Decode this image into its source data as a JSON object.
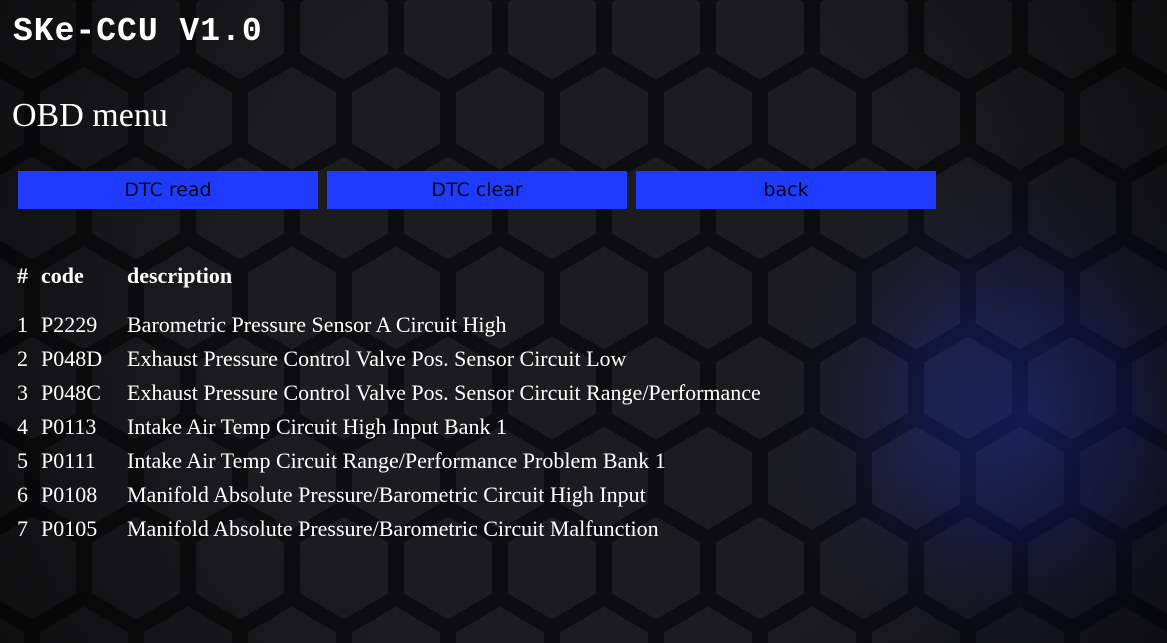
{
  "app": {
    "title": "SKe-CCU V1.0"
  },
  "page": {
    "title": "OBD menu"
  },
  "toolbar": {
    "dtc_read_label": "DTC read",
    "dtc_clear_label": "DTC clear",
    "back_label": "back"
  },
  "dtc_table": {
    "headers": {
      "index": "#",
      "code": "code",
      "description": "description"
    },
    "rows": [
      {
        "index": "1",
        "code": "P2229",
        "description": "Barometric Pressure Sensor A Circuit High"
      },
      {
        "index": "2",
        "code": "P048D",
        "description": "Exhaust Pressure Control Valve Pos. Sensor Circuit Low"
      },
      {
        "index": "3",
        "code": "P048C",
        "description": "Exhaust Pressure Control Valve Pos. Sensor Circuit Range/Performance"
      },
      {
        "index": "4",
        "code": "P0113",
        "description": "Intake Air Temp Circuit High Input Bank 1"
      },
      {
        "index": "5",
        "code": "P0111",
        "description": "Intake Air Temp Circuit Range/Performance Problem Bank 1"
      },
      {
        "index": "6",
        "code": "P0108",
        "description": "Manifold Absolute Pressure/Barometric Circuit High Input"
      },
      {
        "index": "7",
        "code": "P0105",
        "description": "Manifold Absolute Pressure/Barometric Circuit Malfunction"
      }
    ]
  },
  "colors": {
    "background": "#141416",
    "hex_line": "#1f1f22",
    "accent_glow": "#1e3bff",
    "button_bg": "#1e3bff",
    "button_text": "#0a0a1a",
    "text": "#ffffff"
  }
}
